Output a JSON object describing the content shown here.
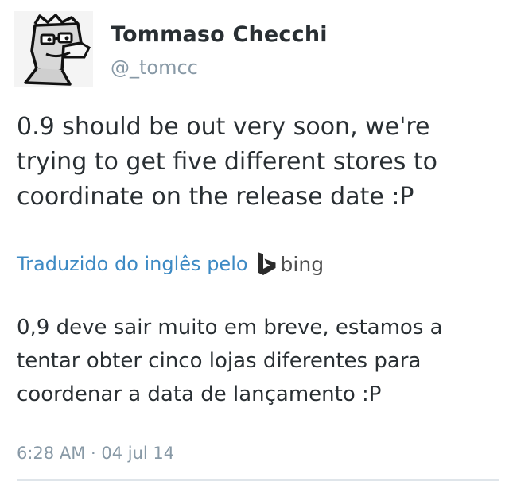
{
  "tweet": {
    "author": {
      "display_name": "Tommaso Checchi",
      "handle": "@_tomcc",
      "avatar_icon": "cartoon-mascot-icon"
    },
    "text": "0.9 should be out very soon, we're trying to get five different stores to coordinate on the release date :P",
    "translation": {
      "credit_label": "Traduzido do inglês pelo",
      "service_name": "bing",
      "service_icon": "bing-logo-icon",
      "text": "0,9 deve sair muito em breve, estamos a tentar obter cinco lojas diferentes para coordenar a data de lançamento :P"
    },
    "timestamp": "6:28 AM · 04 jul 14"
  },
  "colors": {
    "text": "#292f33",
    "muted": "#8899a6",
    "link": "#3d8ac4",
    "bing": "#505050",
    "divider": "#dfe5ea"
  }
}
